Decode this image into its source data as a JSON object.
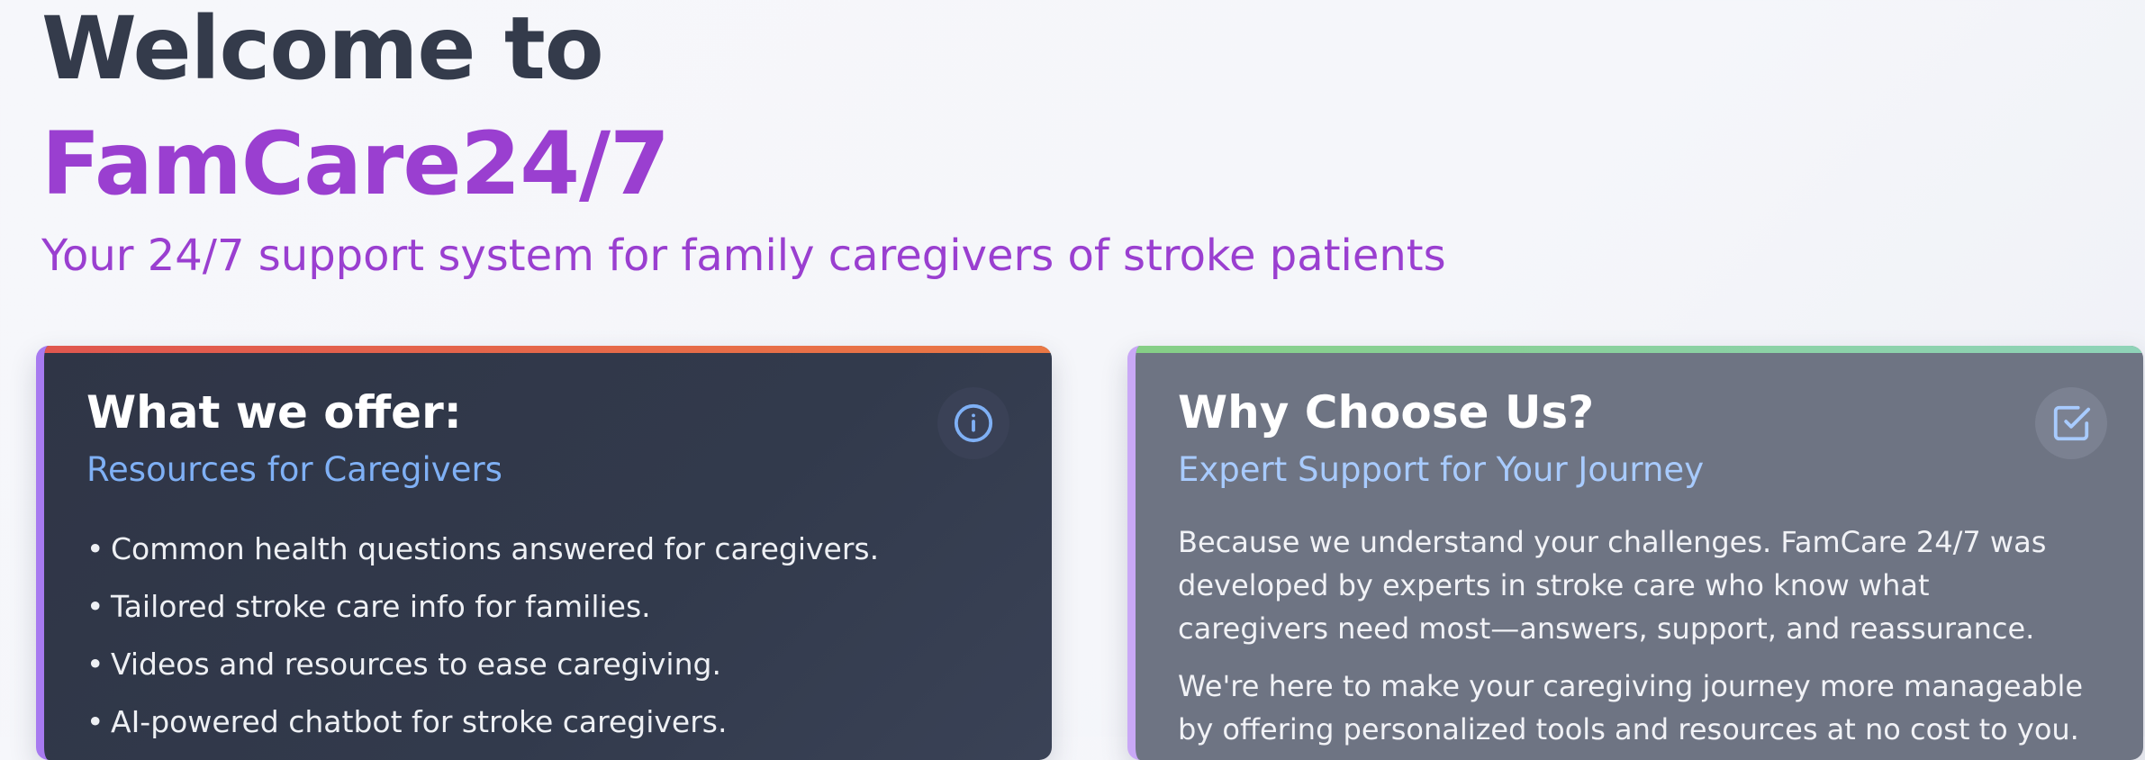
{
  "hero": {
    "title_line1": "Welcome to",
    "title_line2": "FamCare24/7",
    "subtitle": "Your 24/7 support system for family caregivers of stroke patients"
  },
  "cards": {
    "offer": {
      "title": "What we offer:",
      "subtitle": "Resources for Caregivers",
      "icon": "info-icon",
      "accent": "#e0574f",
      "items": [
        "Common health questions answered for caregivers.",
        "Tailored stroke care info for families.",
        "Videos and resources to ease caregiving.",
        "AI-powered chatbot for stroke caregivers."
      ]
    },
    "why": {
      "title": "Why Choose Us?",
      "subtitle": "Expert Support for Your Journey",
      "icon": "checkbox-icon",
      "accent": "#86cf86",
      "paragraphs": [
        "Because we understand your challenges. FamCare 24/7 was developed by experts in stroke care who know what caregivers need most—answers, support, and reassurance.",
        "We're here to make your caregiving journey more manageable by offering personalized tools and resources at no cost to you."
      ]
    }
  },
  "colors": {
    "brand_purple": "#9a3fd0",
    "heading_dark": "#343b4b",
    "subtitle_blue": "#7fb0f5"
  }
}
